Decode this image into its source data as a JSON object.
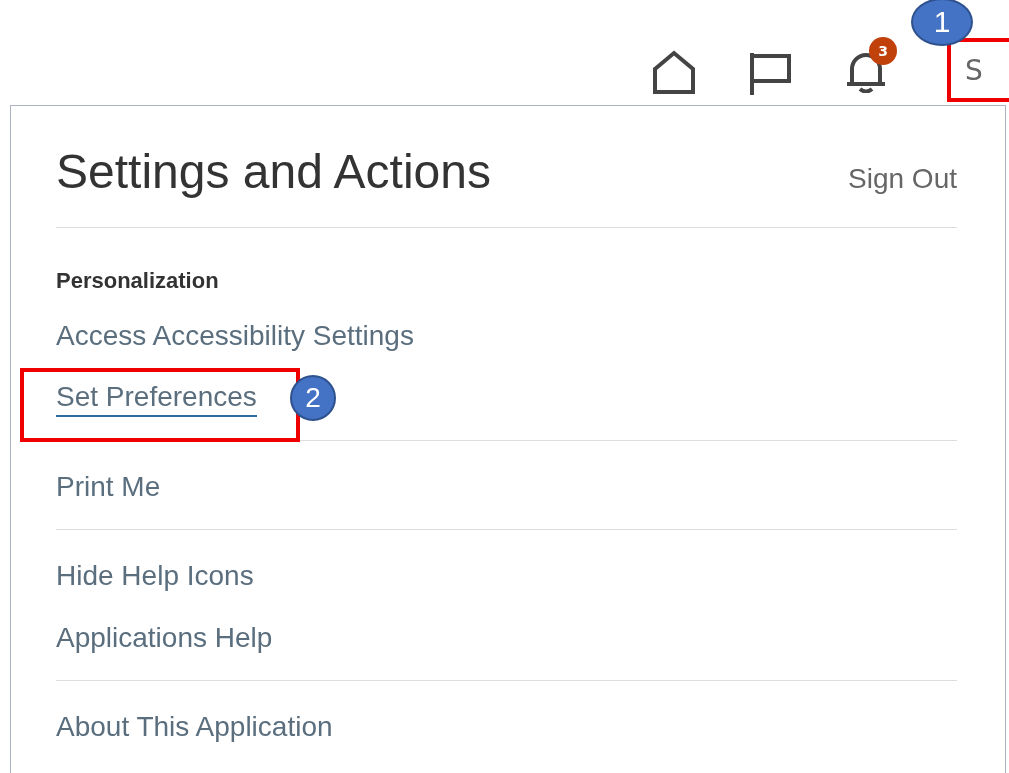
{
  "toolbar": {
    "notification_count": "3",
    "user_initial": "S",
    "user_highlighted": true,
    "user_callout": "1"
  },
  "menu": {
    "title": "Settings and Actions",
    "sign_out": "Sign Out",
    "sections": [
      {
        "heading": "Personalization",
        "items": [
          {
            "label": "Access Accessibility Settings",
            "highlighted": false,
            "focused": false
          },
          {
            "label": "Set Preferences",
            "highlighted": true,
            "focused": true,
            "callout": "2"
          }
        ]
      },
      {
        "items": [
          {
            "label": "Print Me",
            "highlighted": false,
            "focused": false
          }
        ]
      },
      {
        "items": [
          {
            "label": "Hide Help Icons",
            "highlighted": false,
            "focused": false
          },
          {
            "label": "Applications Help",
            "highlighted": false,
            "focused": false
          }
        ]
      },
      {
        "items": [
          {
            "label": "About This Application",
            "highlighted": false,
            "focused": false
          }
        ]
      }
    ]
  }
}
